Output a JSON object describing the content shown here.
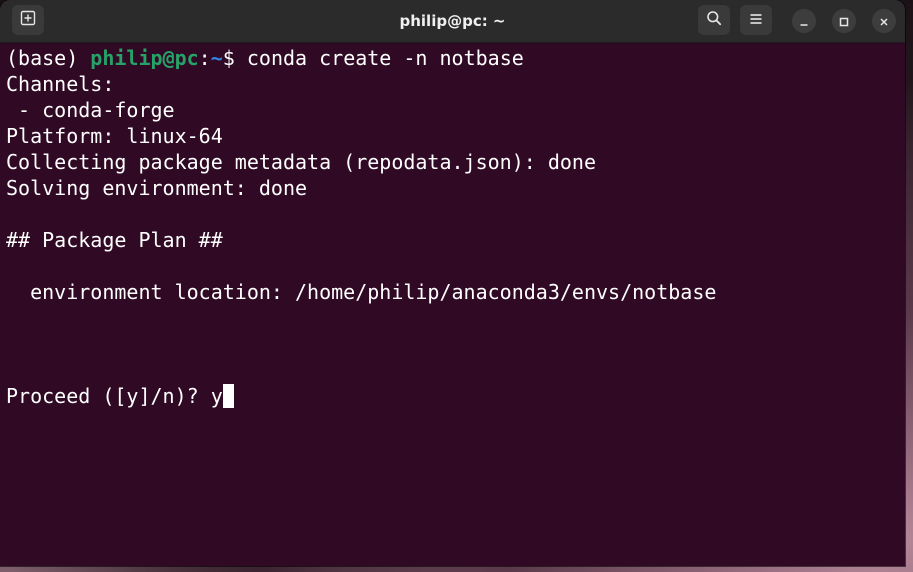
{
  "window": {
    "title": "philip@pc: ~"
  },
  "titlebar": {
    "new_tab_icon": "new-tab-icon",
    "search_icon": "search-icon",
    "menu_icon": "hamburger-menu-icon",
    "minimize_icon": "minimize-icon",
    "maximize_icon": "maximize-icon",
    "close_icon": "close-icon"
  },
  "colors": {
    "terminal_bg": "#300a24",
    "user_host": "#26a269",
    "path": "#3584e4",
    "text": "#ffffff"
  },
  "prompt": {
    "env": "(base) ",
    "user_host": "philip@pc",
    "colon": ":",
    "path": "~",
    "symbol": "$ ",
    "command": "conda create -n notbase"
  },
  "output": {
    "line_1": "Channels:",
    "line_2": " - conda-forge",
    "line_3": "Platform: linux-64",
    "line_4": "Collecting package metadata (repodata.json): done",
    "line_5": "Solving environment: done",
    "line_6": "## Package Plan ##",
    "line_7": "  environment location: /home/philip/anaconda3/envs/notbase",
    "line_8": "Proceed ([y]/n)? ",
    "typed_input": "y"
  }
}
